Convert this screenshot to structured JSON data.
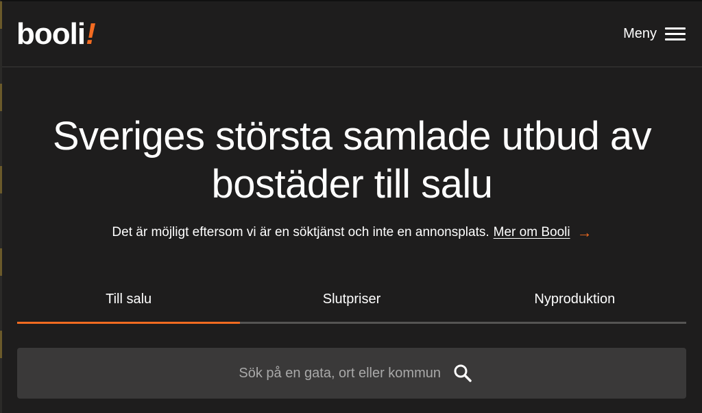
{
  "header": {
    "logo_word": "booli",
    "logo_bang": "!",
    "menu_label": "Meny"
  },
  "hero": {
    "title": "Sveriges största samlade utbud av bostäder till salu",
    "subtitle": "Det är möjligt eftersom vi är en söktjänst och inte en annonsplats.",
    "link_label": "Mer om Booli",
    "link_icon": "arrow-right-icon"
  },
  "tabs": [
    {
      "label": "Till salu",
      "active": true
    },
    {
      "label": "Slutpriser",
      "active": false
    },
    {
      "label": "Nyproduktion",
      "active": false
    }
  ],
  "search": {
    "placeholder": "Sök på en gata, ort eller kommun",
    "value": "",
    "icon": "search-icon"
  },
  "colors": {
    "background": "#1e1d1d",
    "accent": "#f26b21",
    "search_bg": "#3a3939",
    "text": "#ffffff"
  }
}
